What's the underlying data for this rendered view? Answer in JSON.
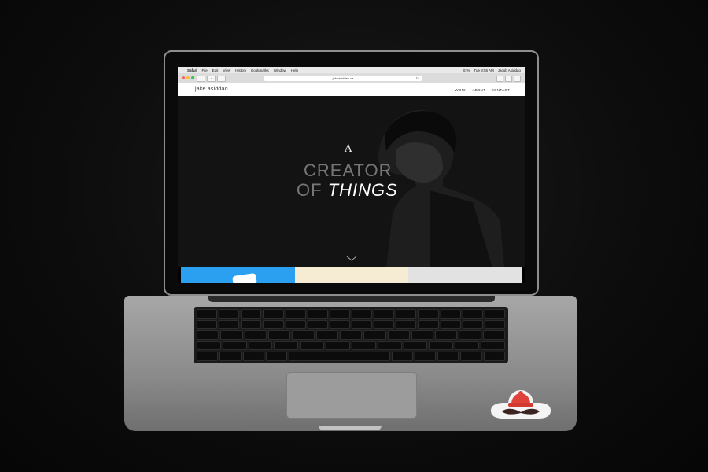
{
  "menubar": {
    "apple": "",
    "items": [
      "Safari",
      "File",
      "Edit",
      "View",
      "History",
      "Bookmarks",
      "Window",
      "Help"
    ],
    "battery": "81%",
    "time": "Tue 8:55 AM",
    "user": "Jacob Asiddao"
  },
  "browser": {
    "url": "jakeasiddao.ca",
    "refresh_icon": "↻"
  },
  "site": {
    "logo": "jake asiddao",
    "nav": [
      "WORK",
      "ABOUT",
      "CONTACT"
    ],
    "monogram": "A",
    "hero_line1": "CREATOR",
    "hero_of": "OF",
    "hero_things": "THINGS"
  },
  "colors": {
    "tile_1": "#2b9ff0",
    "tile_2": "#f6ecd4",
    "tile_3": "#e2e2e2"
  }
}
